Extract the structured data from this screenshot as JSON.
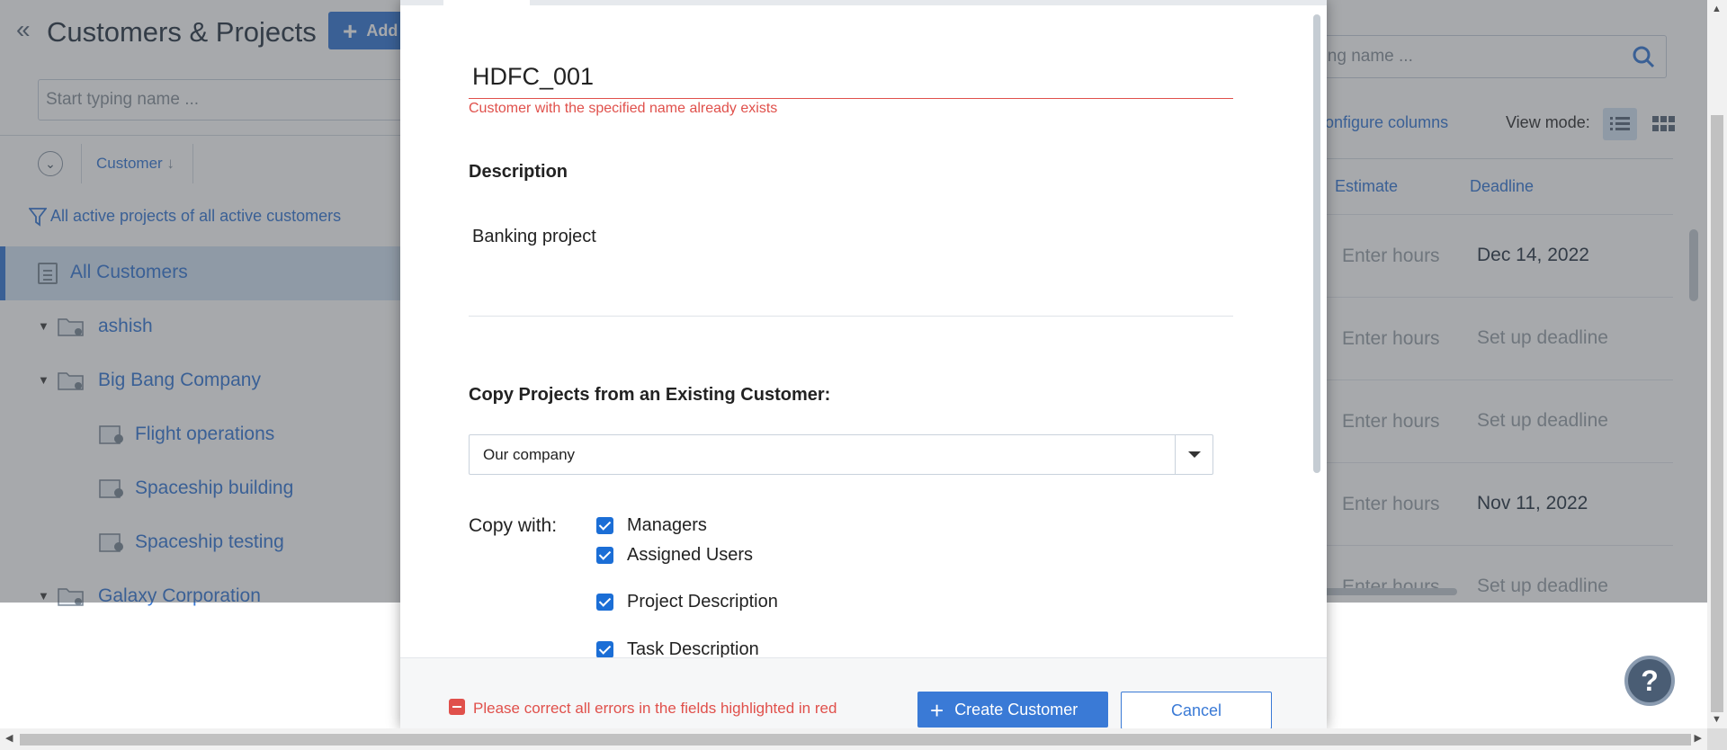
{
  "app": {
    "title": "Customers & Projects",
    "add_button_label": "Add",
    "left_search_placeholder": "Start typing name ...",
    "customer_column_header": "Customer",
    "filter_text": "All active projects of all active customers",
    "all_customers_label": "All Customers",
    "tree": [
      {
        "label": "ashish"
      },
      {
        "label": "Big Bang Company"
      },
      {
        "label": "Flight operations"
      },
      {
        "label": "Spaceship building"
      },
      {
        "label": "Spaceship testing"
      },
      {
        "label": "Galaxy Corporation"
      }
    ],
    "right_search_placeholder": "ping name ...",
    "configure_columns_label": "Configure columns",
    "view_mode_label": "View mode:",
    "estimate_header": "Estimate",
    "deadline_header": "Deadline",
    "rows": [
      {
        "estimate": "Enter hours",
        "deadline": "Dec 14, 2022"
      },
      {
        "estimate": "Enter hours",
        "deadline": "Set up deadline"
      },
      {
        "estimate": "Enter hours",
        "deadline": "Set up deadline"
      },
      {
        "estimate": "Enter hours",
        "deadline": "Nov 11, 2022"
      },
      {
        "estimate": "Enter hours",
        "deadline": "Set up deadline"
      }
    ],
    "help_label": "?"
  },
  "modal": {
    "name_value": "HDFC_001",
    "name_error": "Customer with the specified name already exists",
    "description_label": "Description",
    "description_value": "Banking project",
    "copy_projects_label": "Copy Projects from an Existing Customer:",
    "copy_source_value": "Our company",
    "copy_with_label": "Copy with:",
    "copy_options": [
      {
        "label": "Managers",
        "checked": true
      },
      {
        "label": "Assigned Users",
        "checked": true
      },
      {
        "label": "Project Description",
        "checked": true
      },
      {
        "label": "Task Description",
        "checked": true
      }
    ],
    "footer_error": "Please correct all errors in the fields highlighted in red",
    "create_button_label": "Create Customer",
    "cancel_button_label": "Cancel"
  },
  "colors": {
    "accent": "#3a7ad6",
    "error": "#e0504b",
    "selected_row": "#d4e3f5"
  }
}
